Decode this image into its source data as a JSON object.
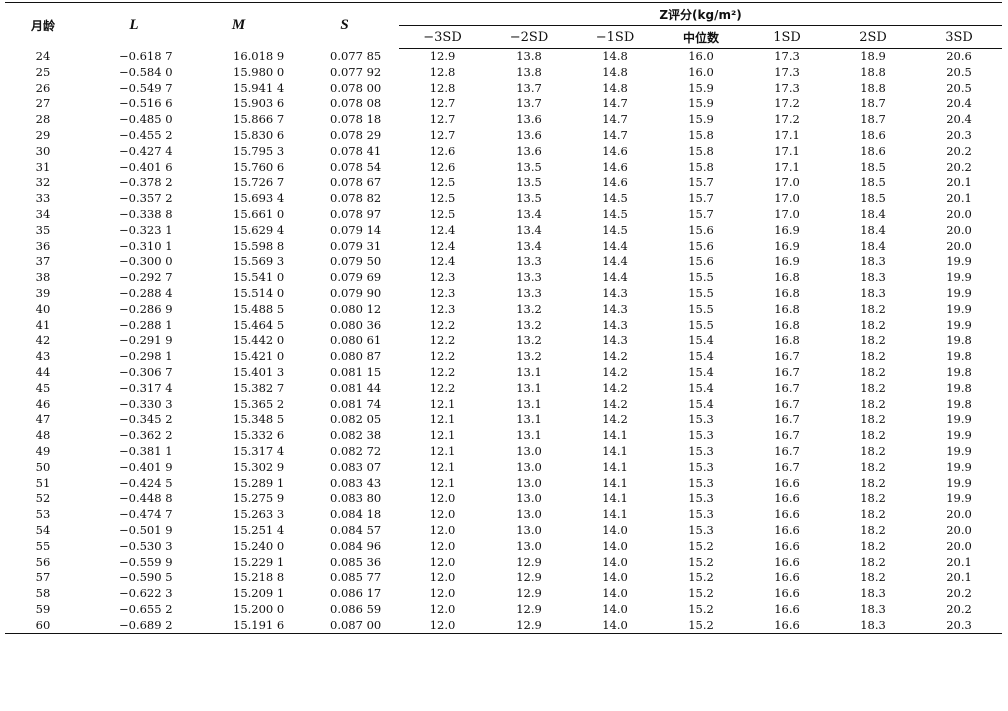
{
  "headers": {
    "month": "月龄",
    "L": "L",
    "M": "M",
    "S": "S",
    "z_group": "Z评分(kg/m²)",
    "z_cols": [
      "−3SD",
      "−2SD",
      "−1SD",
      "中位数",
      "1SD",
      "2SD",
      "3SD"
    ]
  },
  "rows": [
    [
      "24",
      "−0.618 7",
      "16.018 9",
      "0.077 85",
      "12.9",
      "13.8",
      "14.8",
      "16.0",
      "17.3",
      "18.9",
      "20.6"
    ],
    [
      "25",
      "−0.584 0",
      "15.980 0",
      "0.077 92",
      "12.8",
      "13.8",
      "14.8",
      "16.0",
      "17.3",
      "18.8",
      "20.5"
    ],
    [
      "26",
      "−0.549 7",
      "15.941 4",
      "0.078 00",
      "12.8",
      "13.7",
      "14.8",
      "15.9",
      "17.3",
      "18.8",
      "20.5"
    ],
    [
      "27",
      "−0.516 6",
      "15.903 6",
      "0.078 08",
      "12.7",
      "13.7",
      "14.7",
      "15.9",
      "17.2",
      "18.7",
      "20.4"
    ],
    [
      "28",
      "−0.485 0",
      "15.866 7",
      "0.078 18",
      "12.7",
      "13.6",
      "14.7",
      "15.9",
      "17.2",
      "18.7",
      "20.4"
    ],
    [
      "29",
      "−0.455 2",
      "15.830 6",
      "0.078 29",
      "12.7",
      "13.6",
      "14.7",
      "15.8",
      "17.1",
      "18.6",
      "20.3"
    ],
    [
      "30",
      "−0.427 4",
      "15.795 3",
      "0.078 41",
      "12.6",
      "13.6",
      "14.6",
      "15.8",
      "17.1",
      "18.6",
      "20.2"
    ],
    [
      "31",
      "−0.401 6",
      "15.760 6",
      "0.078 54",
      "12.6",
      "13.5",
      "14.6",
      "15.8",
      "17.1",
      "18.5",
      "20.2"
    ],
    [
      "32",
      "−0.378 2",
      "15.726 7",
      "0.078 67",
      "12.5",
      "13.5",
      "14.6",
      "15.7",
      "17.0",
      "18.5",
      "20.1"
    ],
    [
      "33",
      "−0.357 2",
      "15.693 4",
      "0.078 82",
      "12.5",
      "13.5",
      "14.5",
      "15.7",
      "17.0",
      "18.5",
      "20.1"
    ],
    [
      "34",
      "−0.338 8",
      "15.661 0",
      "0.078 97",
      "12.5",
      "13.4",
      "14.5",
      "15.7",
      "17.0",
      "18.4",
      "20.0"
    ],
    [
      "35",
      "−0.323 1",
      "15.629 4",
      "0.079 14",
      "12.4",
      "13.4",
      "14.5",
      "15.6",
      "16.9",
      "18.4",
      "20.0"
    ],
    [
      "36",
      "−0.310 1",
      "15.598 8",
      "0.079 31",
      "12.4",
      "13.4",
      "14.4",
      "15.6",
      "16.9",
      "18.4",
      "20.0"
    ],
    [
      "37",
      "−0.300 0",
      "15.569 3",
      "0.079 50",
      "12.4",
      "13.3",
      "14.4",
      "15.6",
      "16.9",
      "18.3",
      "19.9"
    ],
    [
      "38",
      "−0.292 7",
      "15.541 0",
      "0.079 69",
      "12.3",
      "13.3",
      "14.4",
      "15.5",
      "16.8",
      "18.3",
      "19.9"
    ],
    [
      "39",
      "−0.288 4",
      "15.514 0",
      "0.079 90",
      "12.3",
      "13.3",
      "14.3",
      "15.5",
      "16.8",
      "18.3",
      "19.9"
    ],
    [
      "40",
      "−0.286 9",
      "15.488 5",
      "0.080 12",
      "12.3",
      "13.2",
      "14.3",
      "15.5",
      "16.8",
      "18.2",
      "19.9"
    ],
    [
      "41",
      "−0.288 1",
      "15.464 5",
      "0.080 36",
      "12.2",
      "13.2",
      "14.3",
      "15.5",
      "16.8",
      "18.2",
      "19.9"
    ],
    [
      "42",
      "−0.291 9",
      "15.442 0",
      "0.080 61",
      "12.2",
      "13.2",
      "14.3",
      "15.4",
      "16.8",
      "18.2",
      "19.8"
    ],
    [
      "43",
      "−0.298 1",
      "15.421 0",
      "0.080 87",
      "12.2",
      "13.2",
      "14.2",
      "15.4",
      "16.7",
      "18.2",
      "19.8"
    ],
    [
      "44",
      "−0.306 7",
      "15.401 3",
      "0.081 15",
      "12.2",
      "13.1",
      "14.2",
      "15.4",
      "16.7",
      "18.2",
      "19.8"
    ],
    [
      "45",
      "−0.317 4",
      "15.382 7",
      "0.081 44",
      "12.2",
      "13.1",
      "14.2",
      "15.4",
      "16.7",
      "18.2",
      "19.8"
    ],
    [
      "46",
      "−0.330 3",
      "15.365 2",
      "0.081 74",
      "12.1",
      "13.1",
      "14.2",
      "15.4",
      "16.7",
      "18.2",
      "19.8"
    ],
    [
      "47",
      "−0.345 2",
      "15.348 5",
      "0.082 05",
      "12.1",
      "13.1",
      "14.2",
      "15.3",
      "16.7",
      "18.2",
      "19.9"
    ],
    [
      "48",
      "−0.362 2",
      "15.332 6",
      "0.082 38",
      "12.1",
      "13.1",
      "14.1",
      "15.3",
      "16.7",
      "18.2",
      "19.9"
    ],
    [
      "49",
      "−0.381 1",
      "15.317 4",
      "0.082 72",
      "12.1",
      "13.0",
      "14.1",
      "15.3",
      "16.7",
      "18.2",
      "19.9"
    ],
    [
      "50",
      "−0.401 9",
      "15.302 9",
      "0.083 07",
      "12.1",
      "13.0",
      "14.1",
      "15.3",
      "16.7",
      "18.2",
      "19.9"
    ],
    [
      "51",
      "−0.424 5",
      "15.289 1",
      "0.083 43",
      "12.1",
      "13.0",
      "14.1",
      "15.3",
      "16.6",
      "18.2",
      "19.9"
    ],
    [
      "52",
      "−0.448 8",
      "15.275 9",
      "0.083 80",
      "12.0",
      "13.0",
      "14.1",
      "15.3",
      "16.6",
      "18.2",
      "19.9"
    ],
    [
      "53",
      "−0.474 7",
      "15.263 3",
      "0.084 18",
      "12.0",
      "13.0",
      "14.1",
      "15.3",
      "16.6",
      "18.2",
      "20.0"
    ],
    [
      "54",
      "−0.501 9",
      "15.251 4",
      "0.084 57",
      "12.0",
      "13.0",
      "14.0",
      "15.3",
      "16.6",
      "18.2",
      "20.0"
    ],
    [
      "55",
      "−0.530 3",
      "15.240 0",
      "0.084 96",
      "12.0",
      "13.0",
      "14.0",
      "15.2",
      "16.6",
      "18.2",
      "20.0"
    ],
    [
      "56",
      "−0.559 9",
      "15.229 1",
      "0.085 36",
      "12.0",
      "12.9",
      "14.0",
      "15.2",
      "16.6",
      "18.2",
      "20.1"
    ],
    [
      "57",
      "−0.590 5",
      "15.218 8",
      "0.085 77",
      "12.0",
      "12.9",
      "14.0",
      "15.2",
      "16.6",
      "18.2",
      "20.1"
    ],
    [
      "58",
      "−0.622 3",
      "15.209 1",
      "0.086 17",
      "12.0",
      "12.9",
      "14.0",
      "15.2",
      "16.6",
      "18.3",
      "20.2"
    ],
    [
      "59",
      "−0.655 2",
      "15.200 0",
      "0.086 59",
      "12.0",
      "12.9",
      "14.0",
      "15.2",
      "16.6",
      "18.3",
      "20.2"
    ],
    [
      "60",
      "−0.689 2",
      "15.191 6",
      "0.087 00",
      "12.0",
      "12.9",
      "14.0",
      "15.2",
      "16.6",
      "18.3",
      "20.3"
    ]
  ]
}
